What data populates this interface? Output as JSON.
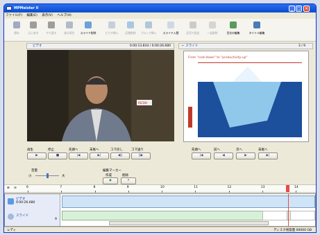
{
  "window": {
    "title": "MPMeister II"
  },
  "menu": [
    "ファイル(F)",
    "編集(E)",
    "表示(V)",
    "ヘルプ(H)"
  ],
  "toolbar": [
    {
      "label": "保存",
      "icon": "save-icon",
      "enabled": false
    },
    {
      "label": "元に戻す",
      "icon": "undo-icon",
      "enabled": false
    },
    {
      "label": "やり直す",
      "icon": "redo-icon",
      "enabled": false
    },
    {
      "label": "部分再生",
      "icon": "play-part-icon",
      "enabled": false
    },
    {
      "label": "スライド削除",
      "icon": "slide-delete-icon",
      "enabled": true
    },
    {
      "label": "ビデオ挿入",
      "icon": "video-insert-icon",
      "enabled": false
    },
    {
      "label": "区間削除",
      "icon": "range-delete-icon",
      "enabled": false
    },
    {
      "label": "ブロック挿入",
      "icon": "block-insert-icon",
      "enabled": false
    },
    {
      "label": "スライド入替",
      "icon": "slide-swap-icon",
      "enabled": true
    },
    {
      "label": "区切り設定",
      "icon": "split-icon",
      "enabled": false
    },
    {
      "label": "一括削除",
      "icon": "bulk-delete-icon",
      "enabled": false
    },
    {
      "label": "目次の編集",
      "icon": "toc-edit-icon",
      "enabled": true
    },
    {
      "label": "タイトル編集",
      "icon": "title-edit-icon",
      "enabled": true
    }
  ],
  "video_panel": {
    "title": "ビデオ",
    "time": "0:00:13.834 / 0:00:26.680"
  },
  "slide_panel": {
    "title": "スライド",
    "page": "3 / 9",
    "slide_title": "From \"cost-down\" to \"productivity-up\""
  },
  "video_controls": {
    "play": "再生",
    "stop": "停止",
    "prev": "先頭へ",
    "next": "末尾へ",
    "frame_back": "コマ戻し",
    "frame_fwd": "コマ送り"
  },
  "slide_controls": {
    "first": "先頭へ",
    "prev": "前へ",
    "next": "次へ",
    "last": "末尾へ"
  },
  "volume": {
    "label": "音量",
    "low": "小",
    "high": "大"
  },
  "bookmark": {
    "label": "編集マーカー",
    "create": "作成",
    "delete": "削除"
  },
  "timeline": {
    "ticks": [
      "6",
      "7",
      "8",
      "9",
      "10",
      "11",
      "12",
      "13",
      "14"
    ],
    "marker_tick": "14"
  },
  "tracks": {
    "video_label": "ビデオ",
    "video_time": "0:00:26.680",
    "slide_label": "スライド",
    "slide_count": "9"
  },
  "status": {
    "left": "レディ",
    "right": "ディスク残容量 00000 GB"
  },
  "colors": {
    "titlebar": "#0a4bd1",
    "accent": "#e84a4a"
  }
}
